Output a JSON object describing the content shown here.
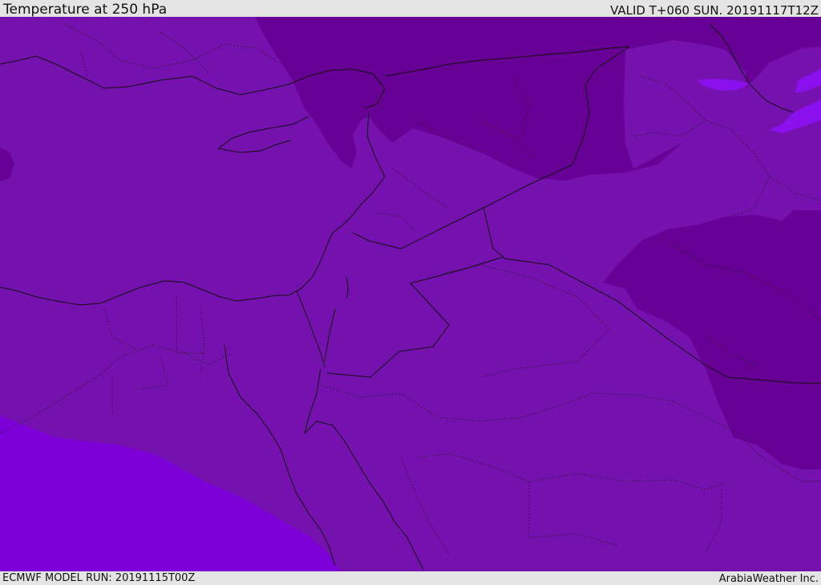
{
  "header": {
    "title": "Temperature at 250 hPa",
    "valid": "VALID T+060 SUN. 20191117T12Z"
  },
  "footer": {
    "model_run": "ECMWF MODEL RUN: 20191115T00Z",
    "credit": "ArabiaWeather Inc."
  },
  "map": {
    "colors": {
      "base": "#7511ae",
      "cold": "#670094",
      "warm": "#7e00d8",
      "warm_spot": "#8a10ee",
      "border": "#111111"
    }
  }
}
